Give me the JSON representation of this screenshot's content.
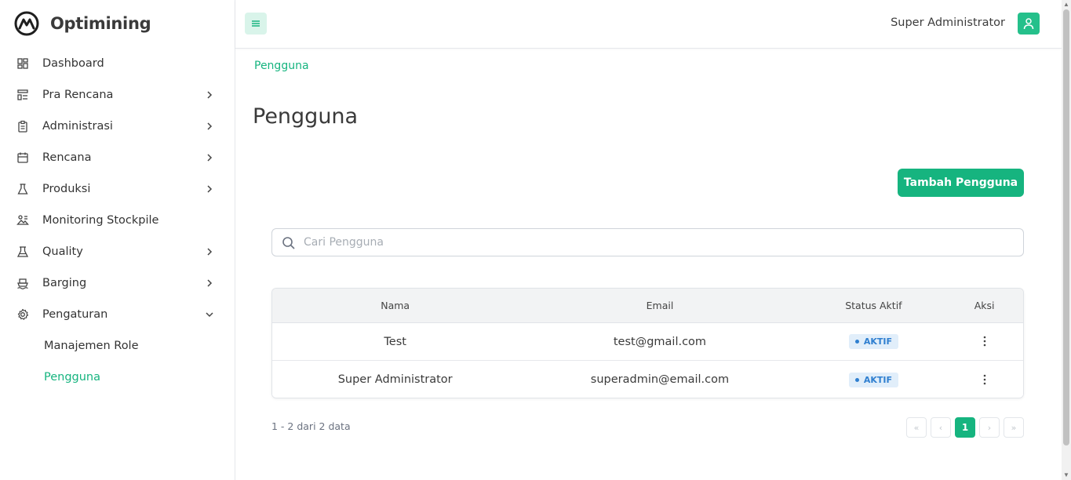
{
  "app": {
    "name": "Optimining"
  },
  "sidebar": {
    "items": [
      {
        "label": "Dashboard",
        "icon": "dashboard-icon",
        "has_children": false
      },
      {
        "label": "Pra Rencana",
        "icon": "list-icon",
        "has_children": true
      },
      {
        "label": "Administrasi",
        "icon": "clipboard-icon",
        "has_children": true
      },
      {
        "label": "Rencana",
        "icon": "calendar-icon",
        "has_children": true
      },
      {
        "label": "Produksi",
        "icon": "flask-icon",
        "has_children": true
      },
      {
        "label": "Monitoring Stockpile",
        "icon": "stockpile-icon",
        "has_children": false
      },
      {
        "label": "Quality",
        "icon": "beaker-icon",
        "has_children": true
      },
      {
        "label": "Barging",
        "icon": "ship-icon",
        "has_children": true
      },
      {
        "label": "Pengaturan",
        "icon": "gear-icon",
        "has_children": true,
        "expanded": true
      }
    ],
    "subitems": [
      {
        "label": "Manajemen Role",
        "active": false
      },
      {
        "label": "Pengguna",
        "active": true
      }
    ]
  },
  "header": {
    "user_name": "Super Administrator"
  },
  "breadcrumb": "Pengguna",
  "page_title": "Pengguna",
  "add_button": "Tambah Pengguna",
  "search": {
    "placeholder": "Cari Pengguna",
    "value": ""
  },
  "table": {
    "columns": [
      "Nama",
      "Email",
      "Status Aktif",
      "Aksi"
    ],
    "rows": [
      {
        "name": "Test",
        "email": "test@gmail.com",
        "status": "AKTIF"
      },
      {
        "name": "Super Administrator",
        "email": "superadmin@email.com",
        "status": "AKTIF"
      }
    ]
  },
  "pagination": {
    "summary": "1 - 2 dari 2 data",
    "first": "«",
    "prev": "‹",
    "current": "1",
    "next": "›",
    "last": "»"
  },
  "colors": {
    "accent": "#16b47f",
    "badge_bg": "#e1eefa",
    "badge_text": "#2f7fd0"
  }
}
